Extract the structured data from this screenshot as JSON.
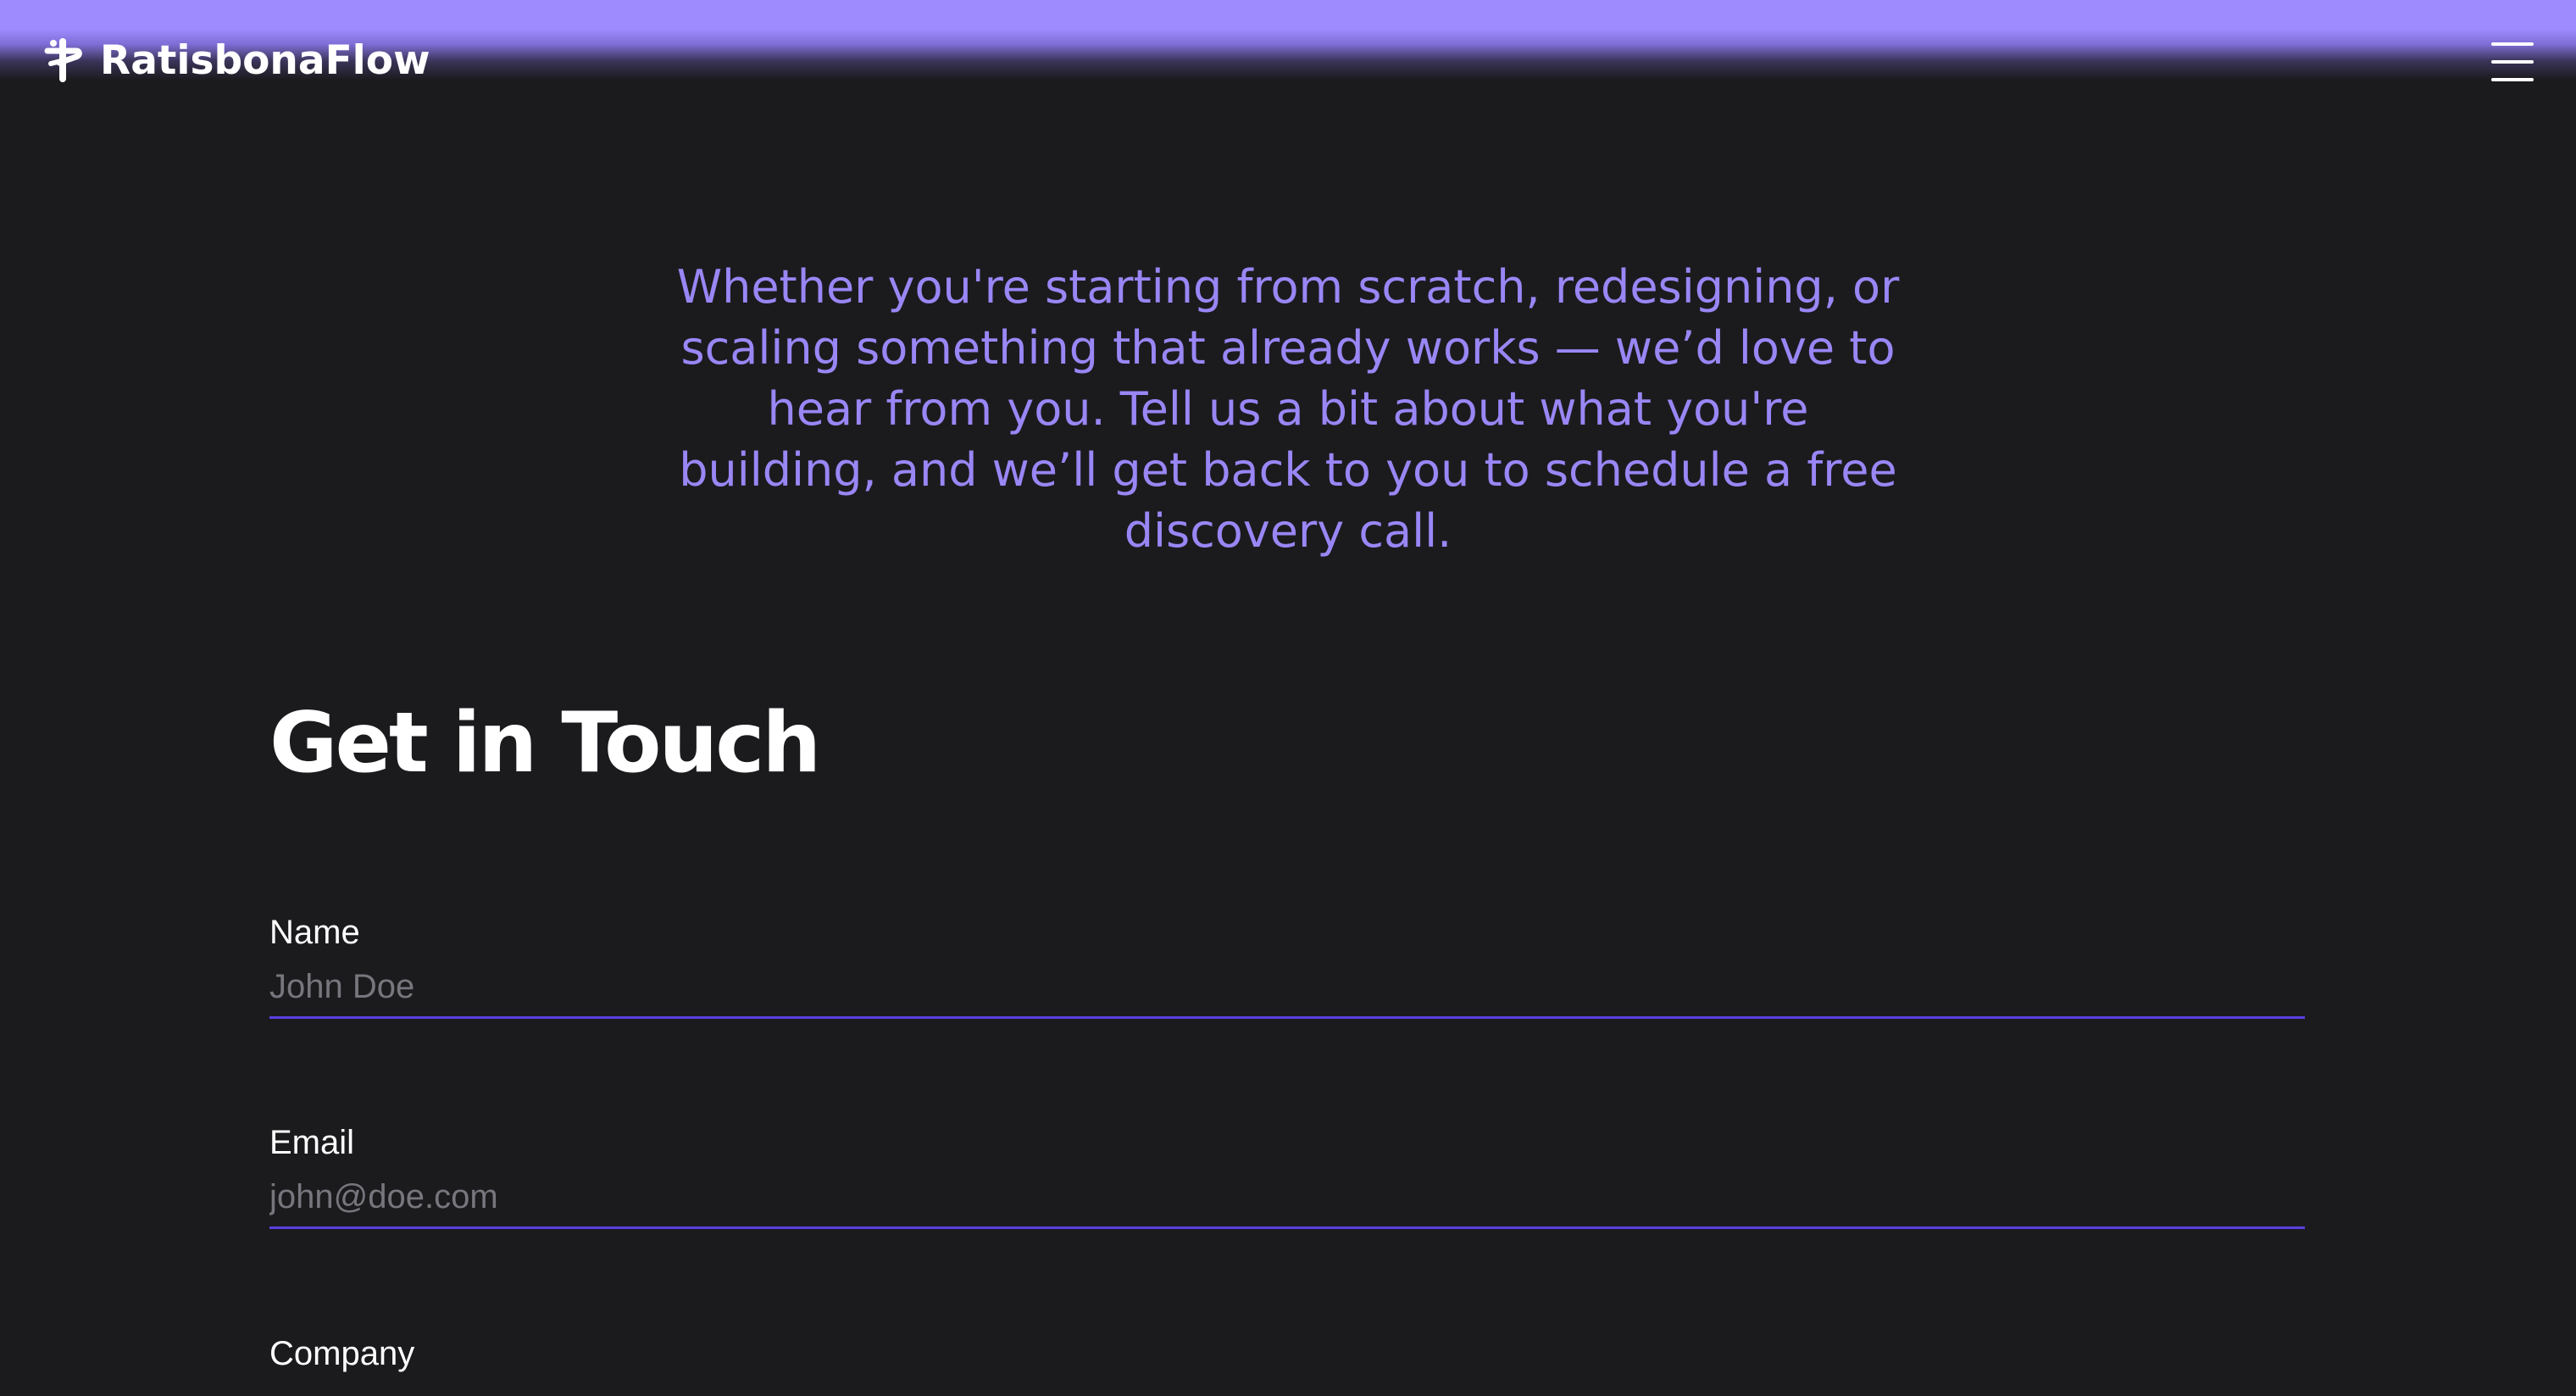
{
  "brand": {
    "name": "RatisbonaFlow",
    "icon": "ratisbonaflow-logo-icon"
  },
  "nav": {
    "menu_icon": "hamburger-menu-icon"
  },
  "intro": {
    "text": "Whether you're starting from scratch, redesigning, or scaling something that already works — we’d love to hear from you. Tell us a bit about what you're building, and we’ll get back to you to schedule a free discovery call."
  },
  "contact": {
    "heading": "Get in Touch",
    "fields": {
      "name": {
        "label": "Name",
        "placeholder": "John Doe",
        "value": ""
      },
      "email": {
        "label": "Email",
        "placeholder": "john@doe.com",
        "value": ""
      },
      "company": {
        "label": "Company"
      }
    }
  },
  "colors": {
    "background": "#1b1b1e",
    "accent": "#9a86f5",
    "top_glow": "#9e8cff",
    "field_underline": "#5b3fe0",
    "placeholder": "#77767d"
  }
}
